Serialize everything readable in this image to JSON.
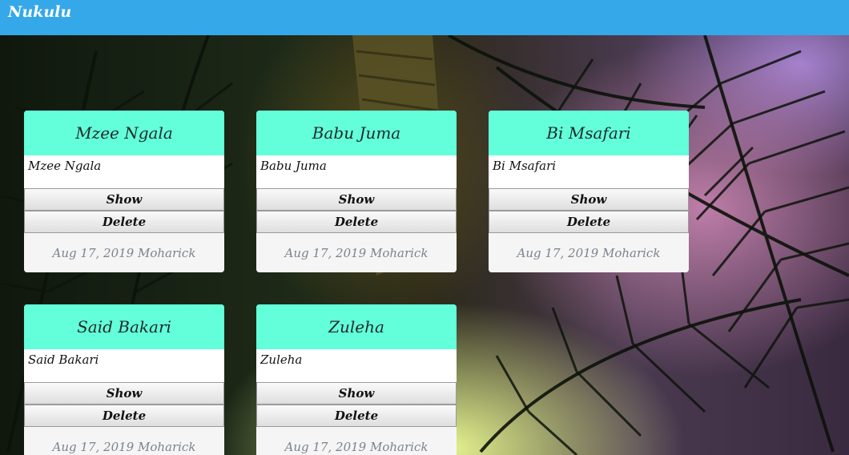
{
  "app": {
    "brand": "Nukulu"
  },
  "colors": {
    "navbar": "#34a8e8",
    "card_header": "#63ffda",
    "footer_text": "#7a8390"
  },
  "cards": [
    {
      "title": "Mzee Ngala",
      "body": "Mzee Ngala",
      "show_label": "Show",
      "delete_label": "Delete",
      "footer": "Aug 17, 2019 Moharick"
    },
    {
      "title": "Babu Juma",
      "body": "Babu Juma",
      "show_label": "Show",
      "delete_label": "Delete",
      "footer": "Aug 17, 2019 Moharick"
    },
    {
      "title": "Bi Msafari",
      "body": "Bi Msafari",
      "show_label": "Show",
      "delete_label": "Delete",
      "footer": "Aug 17, 2019 Moharick"
    },
    {
      "title": "Said Bakari",
      "body": "Said Bakari",
      "show_label": "Show",
      "delete_label": "Delete",
      "footer": "Aug 17, 2019 Moharick"
    },
    {
      "title": "Zuleha",
      "body": "Zuleha",
      "show_label": "Show",
      "delete_label": "Delete",
      "footer": "Aug 17, 2019 Moharick"
    }
  ]
}
